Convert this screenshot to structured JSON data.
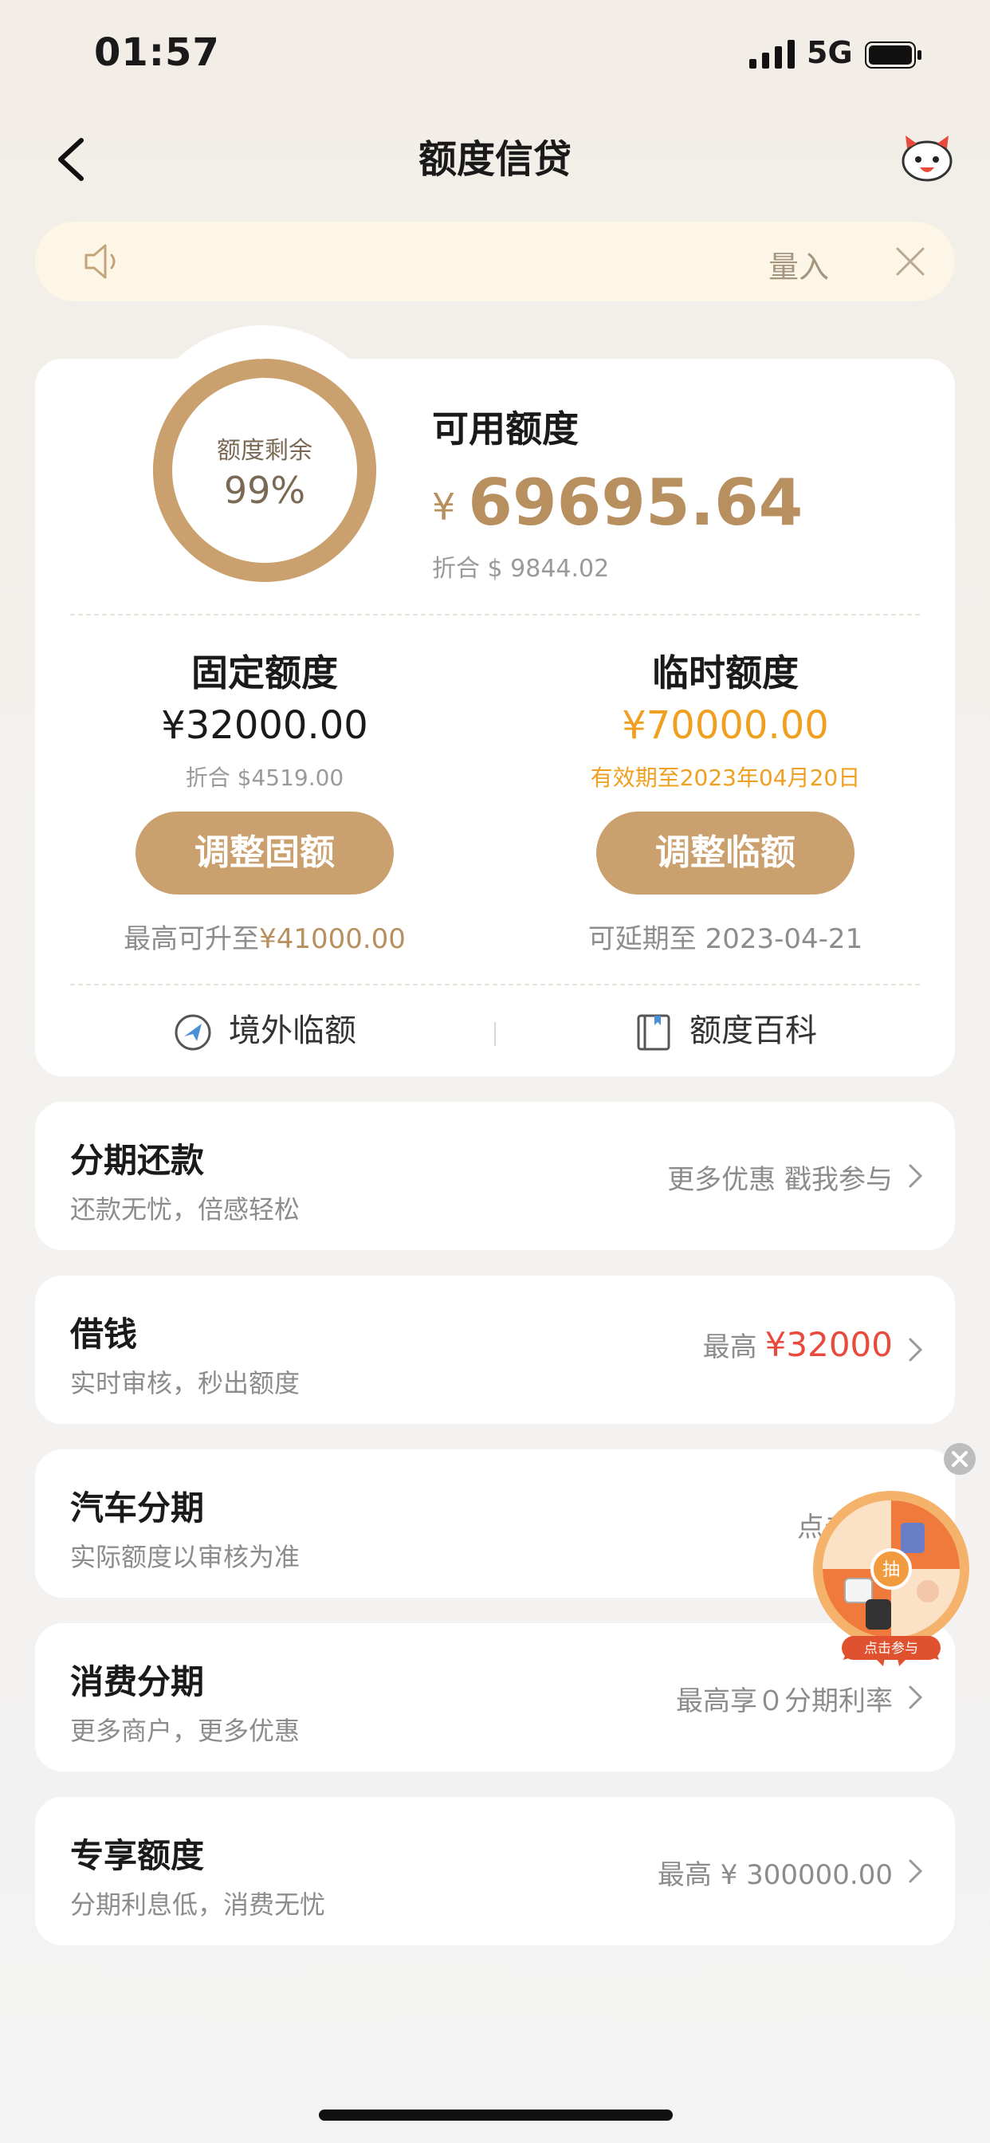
{
  "status": {
    "time": "01:57",
    "network": "5G"
  },
  "nav": {
    "title": "额度信贷"
  },
  "notice": {
    "text": "量入"
  },
  "summary": {
    "ring_label": "额度剩余",
    "ring_percent": "99%",
    "ring_fraction": 0.99,
    "available_label": "可用额度",
    "currency": "¥",
    "available_amount": "69695.64",
    "available_usd": "折合 $ 9844.02"
  },
  "fixed": {
    "title": "固定额度",
    "amount": "¥32000.00",
    "usd": "折合 $4519.00",
    "button": "调整固额",
    "foot_prefix": "最高可升至",
    "foot_value": "¥41000.00"
  },
  "temp": {
    "title": "临时额度",
    "amount": "¥70000.00",
    "validity": "有效期至2023年04月20日",
    "button": "调整临额",
    "foot": "可延期至 2023-04-21"
  },
  "links": {
    "overseas": "境外临额",
    "encyclopedia": "额度百科"
  },
  "items": [
    {
      "title": "分期还款",
      "sub": "还款无忧，倍感轻松",
      "right": "更多优惠 戳我参与"
    },
    {
      "title": "借钱",
      "sub": "实时审核，秒出额度",
      "right_prefix": "最高",
      "right_value": "¥32000"
    },
    {
      "title": "汽车分期",
      "sub": "实际额度以审核为准",
      "right": "点击"
    },
    {
      "title": "消费分期",
      "sub": "更多商户，更多优惠",
      "right": "最高享０分期利率"
    },
    {
      "title": "专享额度",
      "sub": "分期利息低，消费无忧",
      "right": "最高 ¥ 300000.00"
    }
  ],
  "lottery": {
    "center": "抽",
    "ribbon": "点击参与"
  },
  "colors": {
    "accent_gold": "#c9a06e",
    "amount_gold": "#b88f5e",
    "red": "#e84a3c",
    "orange": "#f0a020",
    "notice_bg": "#fdf5e6"
  }
}
